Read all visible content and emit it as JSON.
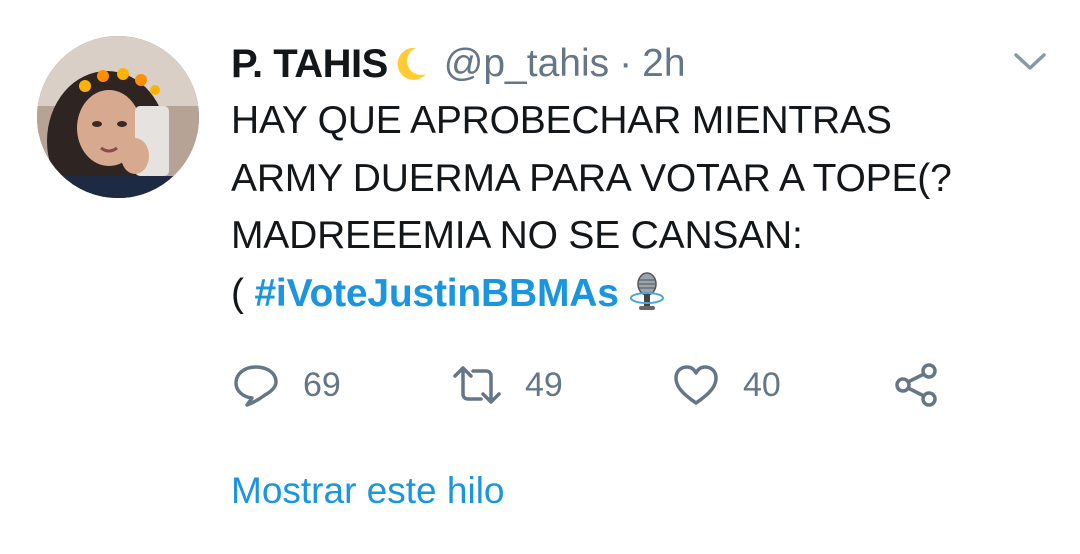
{
  "tweet": {
    "display_name": "P. TAHIS",
    "name_emoji": "crescent-moon-emoji",
    "handle": "@p_tahis",
    "separator": "·",
    "time": "2h",
    "text_lines": [
      "HAY QUE APROBECHAR MIENTRAS",
      "ARMY DUERMA PARA VOTAR A TOPE(?",
      "MADREEEMIA NO SE CANSAN:"
    ],
    "text_last_prefix": "( ",
    "hashtag": "#iVoteJustinBBMAs",
    "hashtag_emoji": "microphone-emoji"
  },
  "actions": {
    "reply_count": "69",
    "retweet_count": "49",
    "like_count": "40"
  },
  "show_thread_label": "Mostrar este hilo",
  "colors": {
    "text": "#14171a",
    "secondary": "#657786",
    "link": "#1b95e0",
    "icon": "#657786"
  }
}
